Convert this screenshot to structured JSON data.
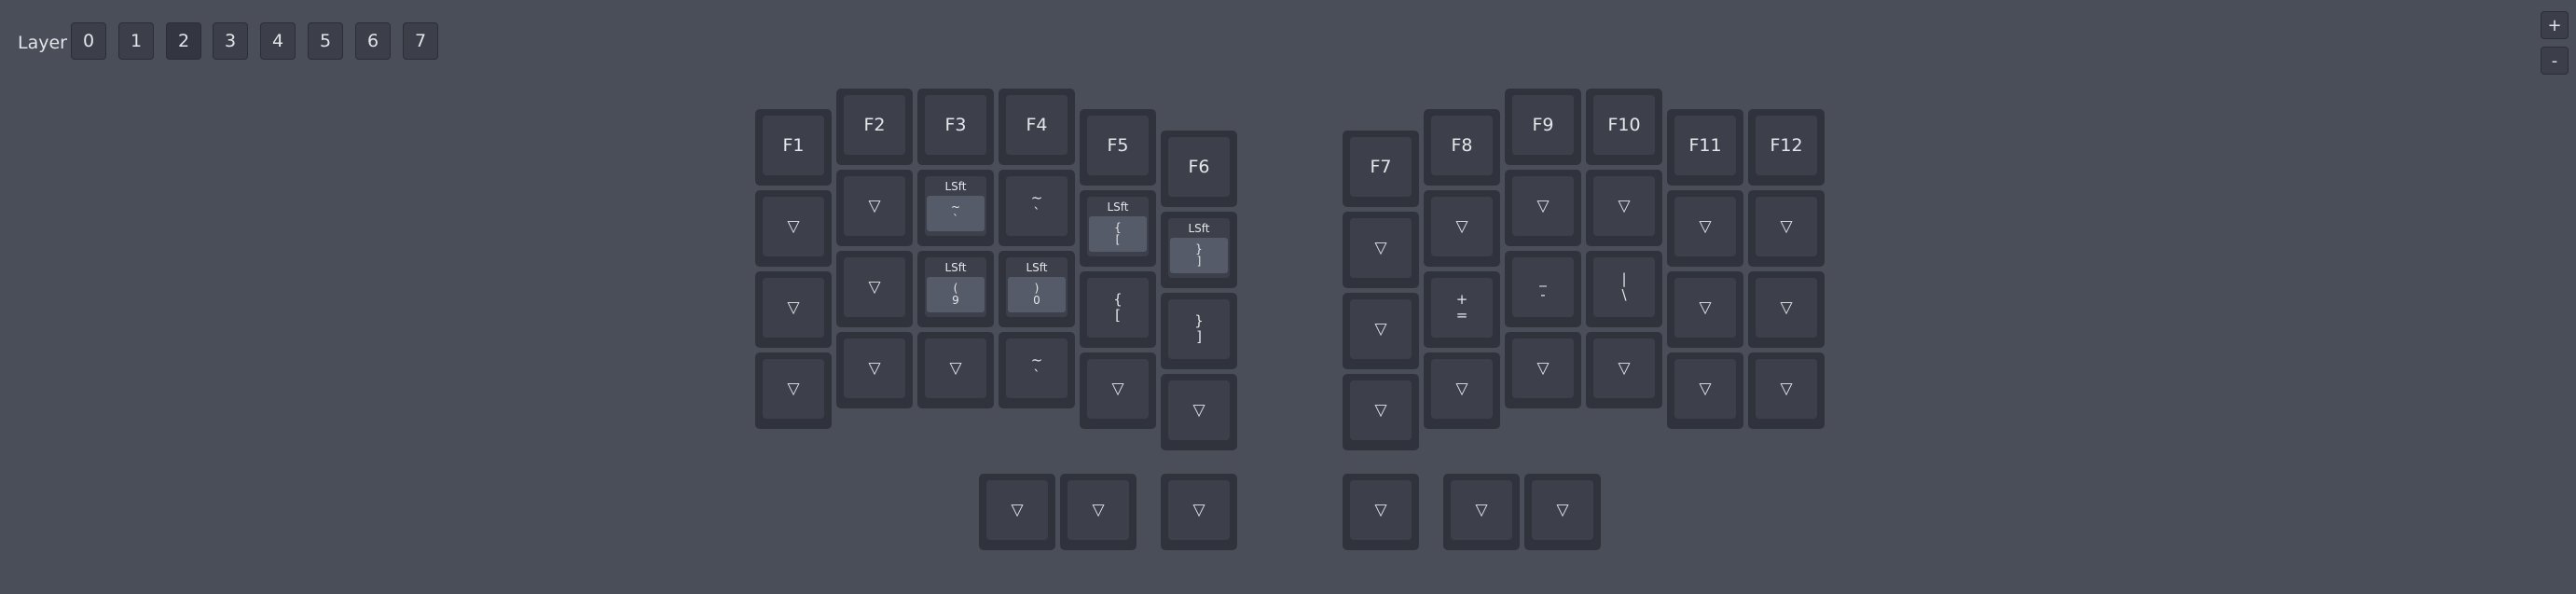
{
  "toolbar": {
    "layer_label": "Layer",
    "layers": [
      "0",
      "1",
      "2",
      "3",
      "4",
      "5",
      "6",
      "7"
    ],
    "active_layer": "2",
    "zoom_in": "+",
    "zoom_out": "-"
  },
  "keyboard": {
    "trans_symbol": "▽",
    "left": {
      "row0": [
        "F1",
        "F2",
        "F3",
        "F4",
        "F5",
        "F6"
      ],
      "row1": [
        {
          "type": "trans"
        },
        {
          "type": "trans"
        },
        {
          "type": "mod",
          "mod": "LSft",
          "inner": "~\n`"
        },
        {
          "type": "label",
          "label": "~\n`"
        },
        {
          "type": "mod",
          "mod": "LSft",
          "inner": "{\n["
        },
        {
          "type": "mod",
          "mod": "LSft",
          "inner": "}\n]"
        }
      ],
      "row2": [
        {
          "type": "trans"
        },
        {
          "type": "trans"
        },
        {
          "type": "mod",
          "mod": "LSft",
          "inner": "(\n9"
        },
        {
          "type": "mod",
          "mod": "LSft",
          "inner": ")\n0"
        },
        {
          "type": "label",
          "label": "{\n["
        },
        {
          "type": "label",
          "label": "}\n]"
        }
      ],
      "row3": [
        {
          "type": "trans"
        },
        {
          "type": "trans"
        },
        {
          "type": "trans"
        },
        {
          "type": "label",
          "label": "~\n`"
        },
        {
          "type": "trans"
        },
        {
          "type": "trans"
        }
      ],
      "thumbs": [
        {
          "type": "trans"
        },
        {
          "type": "trans"
        },
        {
          "type": "trans"
        }
      ]
    },
    "right": {
      "row0": [
        "F7",
        "F8",
        "F9",
        "F10",
        "F11",
        "F12"
      ],
      "row1": [
        {
          "type": "trans"
        },
        {
          "type": "trans"
        },
        {
          "type": "trans"
        },
        {
          "type": "trans"
        },
        {
          "type": "trans"
        },
        {
          "type": "trans"
        }
      ],
      "row2": [
        {
          "type": "trans"
        },
        {
          "type": "label",
          "label": "+\n="
        },
        {
          "type": "label",
          "label": "_\n-"
        },
        {
          "type": "label",
          "label": "|\n\\"
        },
        {
          "type": "trans"
        },
        {
          "type": "trans"
        }
      ],
      "row3": [
        {
          "type": "trans"
        },
        {
          "type": "trans"
        },
        {
          "type": "trans"
        },
        {
          "type": "trans"
        },
        {
          "type": "trans"
        },
        {
          "type": "trans"
        }
      ],
      "thumbs": [
        {
          "type": "trans"
        },
        {
          "type": "trans"
        },
        {
          "type": "trans"
        }
      ]
    }
  }
}
